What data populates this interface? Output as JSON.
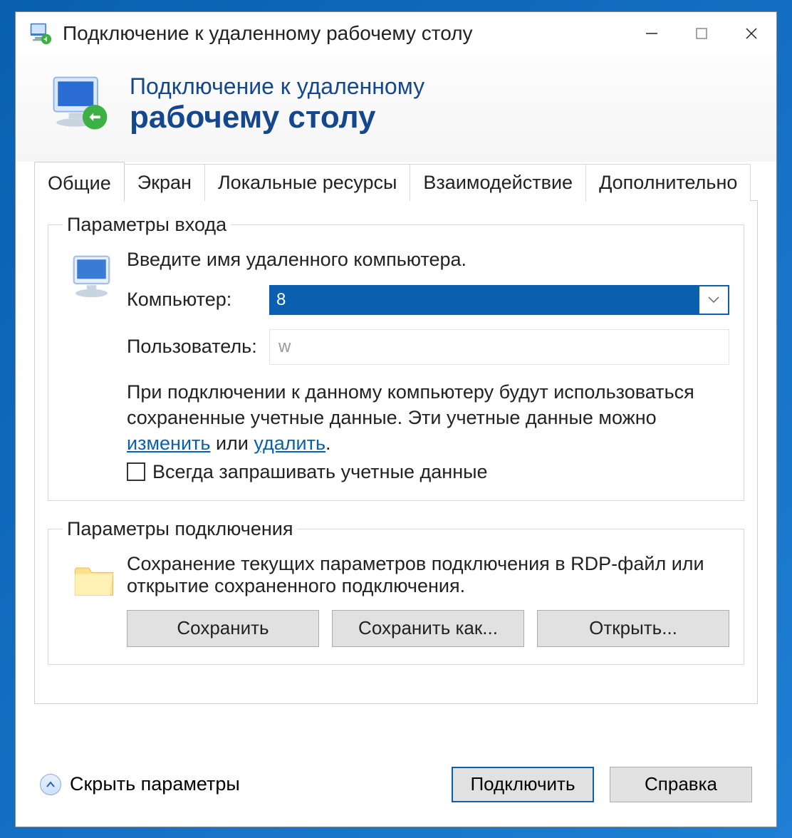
{
  "titlebar": {
    "title": "Подключение к удаленному рабочему столу"
  },
  "header": {
    "line1": "Подключение к удаленному",
    "line2": "рабочему столу"
  },
  "tabs": [
    {
      "label": "Общие"
    },
    {
      "label": "Экран"
    },
    {
      "label": "Локальные ресурсы"
    },
    {
      "label": "Взаимодействие"
    },
    {
      "label": "Дополнительно"
    }
  ],
  "login_group": {
    "legend": "Параметры входа",
    "prompt": "Введите имя удаленного компьютера.",
    "computer_label": "Компьютер:",
    "computer_value": "8",
    "user_label": "Пользователь:",
    "user_value": "w",
    "saved_creds_part1": "При подключении к данному компьютеру будут использоваться сохраненные учетные данные.  Эти учетные данные можно ",
    "link_edit": "изменить",
    "saved_creds_part2": " или ",
    "link_delete": "удалить",
    "saved_creds_part3": ".",
    "checkbox_label": "Всегда запрашивать учетные данные"
  },
  "conn_group": {
    "legend": "Параметры подключения",
    "desc": "Сохранение текущих параметров подключения в RDP-файл или открытие сохраненного подключения.",
    "save": "Сохранить",
    "save_as": "Сохранить как...",
    "open": "Открыть..."
  },
  "footer": {
    "hide": "Скрыть параметры",
    "connect": "Подключить",
    "help": "Справка"
  }
}
